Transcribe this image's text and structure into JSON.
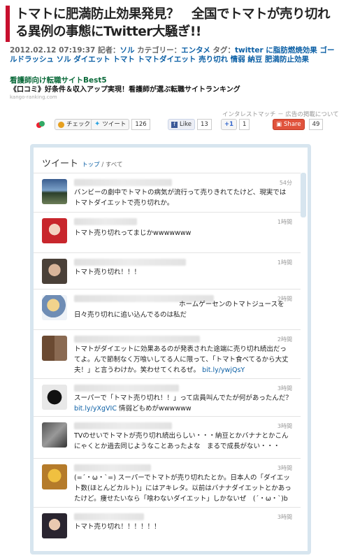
{
  "article": {
    "title": "トマトに肥満防止効果発見？　全国でトマトが売り切れる異例の事態にTwitter大騒ぎ!!",
    "meta_prefix": "2012.02.12 07:19:37 記者：",
    "author": "ソル",
    "category_label": " カテゴリー：",
    "category": "エンタメ",
    "tags_label": " タグ：",
    "tags": "twitter に脂肪燃焼効果 ゴールドラッシュ ソル ダイエット トマト トマトダイエット 売り切れ 情弱 納豆 肥満防止効果"
  },
  "ad": {
    "title": "看護師向け転職サイトBest5",
    "text": "《口コミ》好条件＆収入アップ実現！看護師が選ぶ転職サイトランキング",
    "url": "kango-ranking.com",
    "note": "インタレストマッチ － 広告の掲載について"
  },
  "share": {
    "check_label": "チェック",
    "tweet_label": "ツイート",
    "tweet_count": "126",
    "like_label": "Like",
    "like_count": "13",
    "plus_label": "+1",
    "plus_count": "1",
    "share_label": "Share",
    "share_count": "49"
  },
  "widget": {
    "title": "ツイート",
    "tab_top": "トップ",
    "tab_sep": " / ",
    "tab_all": "すべて"
  },
  "tweets": [
    {
      "time": "54分",
      "text": "バンビーの劇中でトマトの病気が流行って売りきれてたけど、現実ではトマトダイエットで売り切れか。",
      "link": ""
    },
    {
      "time": "1時間",
      "text": "トマト売り切れってまじかwwwwwww",
      "link": ""
    },
    {
      "time": "1時間",
      "text": "トマト売り切れ！！！",
      "link": ""
    },
    {
      "time": "2時間",
      "text": "ホームゲーセンのトマトジュースを日々売り切れに追い込んでるのは私だ",
      "link": ""
    },
    {
      "time": "2時間",
      "text": "トマトがダイエットに効果あるのが発表された途端に売り切れ続出だってよ。んで節制なく万喰いしてる人に限って、「トマト食べてるから大丈夫！」と言うわけか。笑わせてくれるぜ。",
      "link": "bit.ly/ywjQsY"
    },
    {
      "time": "3時間",
      "text": "スーパーで「トマト売り切れ！！」って店員叫んでたが何があったんだ？",
      "link": "bit.ly/yXgVIC",
      "after": " 情弱どもめがwwwwww"
    },
    {
      "time": "3時間",
      "text": "TVのせいでトマトが売り切れ続出らしい・・・納豆とかバナナとかこんにゃくとか過去同じようなことあったよな　まるで成長がない・・・",
      "link": ""
    },
    {
      "time": "3時間",
      "text": "(=´・ω・`=) スーパーでトマトが売り切れたとか。日本人の「ダイエット数(ほとんどカルト)」にはアキレタ。以前はバナナダイエットとかあったけど。痩せたいなら「喰わないダイエット」しかないぜ　(´・ω・`)b",
      "link": ""
    },
    {
      "time": "3時間",
      "text": "トマト売り切れ！！！！！！",
      "link": ""
    }
  ],
  "colors": {
    "accent": "#c8102e",
    "link": "#0b5fa5",
    "widget_border": "#d7e5ef",
    "share_red": "#e0533c",
    "facebook": "#3b5998"
  }
}
